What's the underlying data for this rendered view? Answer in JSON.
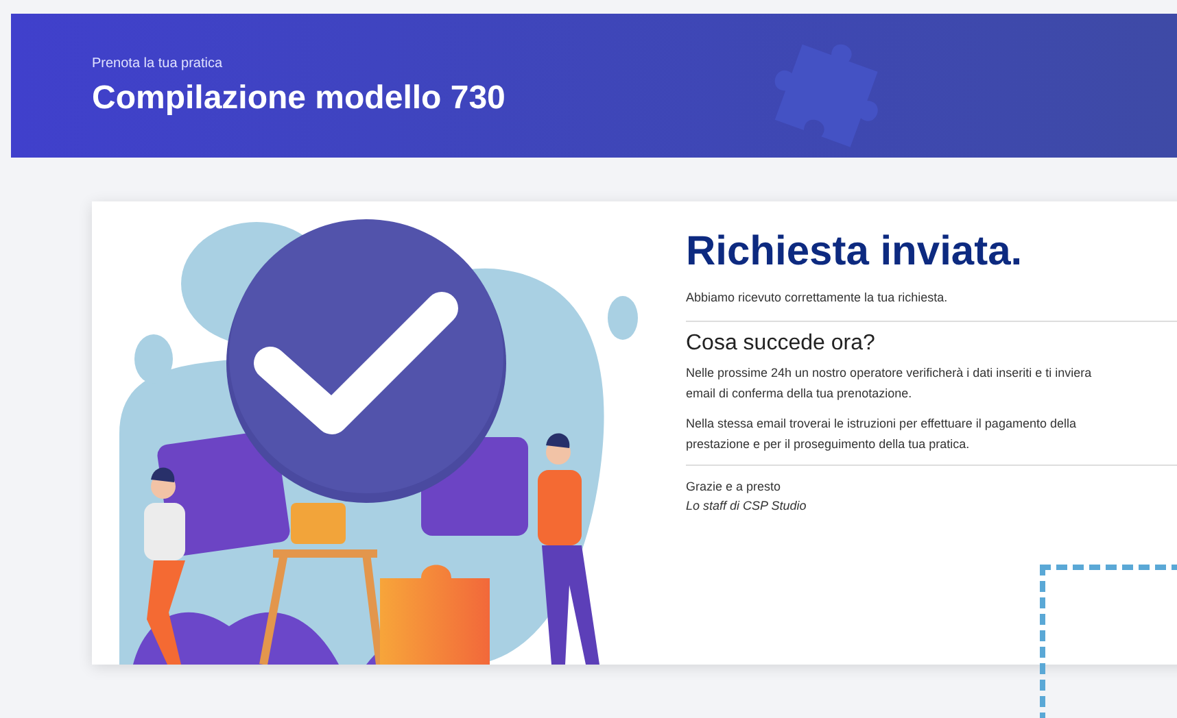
{
  "header": {
    "eyebrow": "Prenota la tua pratica",
    "title": "Compilazione modello 730"
  },
  "confirmation": {
    "title": "Richiesta inviata.",
    "subtitle": "Abbiamo ricevuto correttamente la tua richiesta.",
    "section_title": "Cosa succede ora?",
    "paragraphs": [
      {
        "lines": [
          "Nelle prossime 24h un nostro operatore verificherà i dati inseriti e ti inviera",
          "email di conferma della tua prenotazione."
        ]
      },
      {
        "lines": [
          "Nella stessa email troverai le istruzioni per effettuare il pagamento della",
          "prestazione e per il proseguimento della tua pratica."
        ]
      }
    ],
    "closing": "Grazie e a presto",
    "signature": "Lo staff di CSP Studio"
  }
}
